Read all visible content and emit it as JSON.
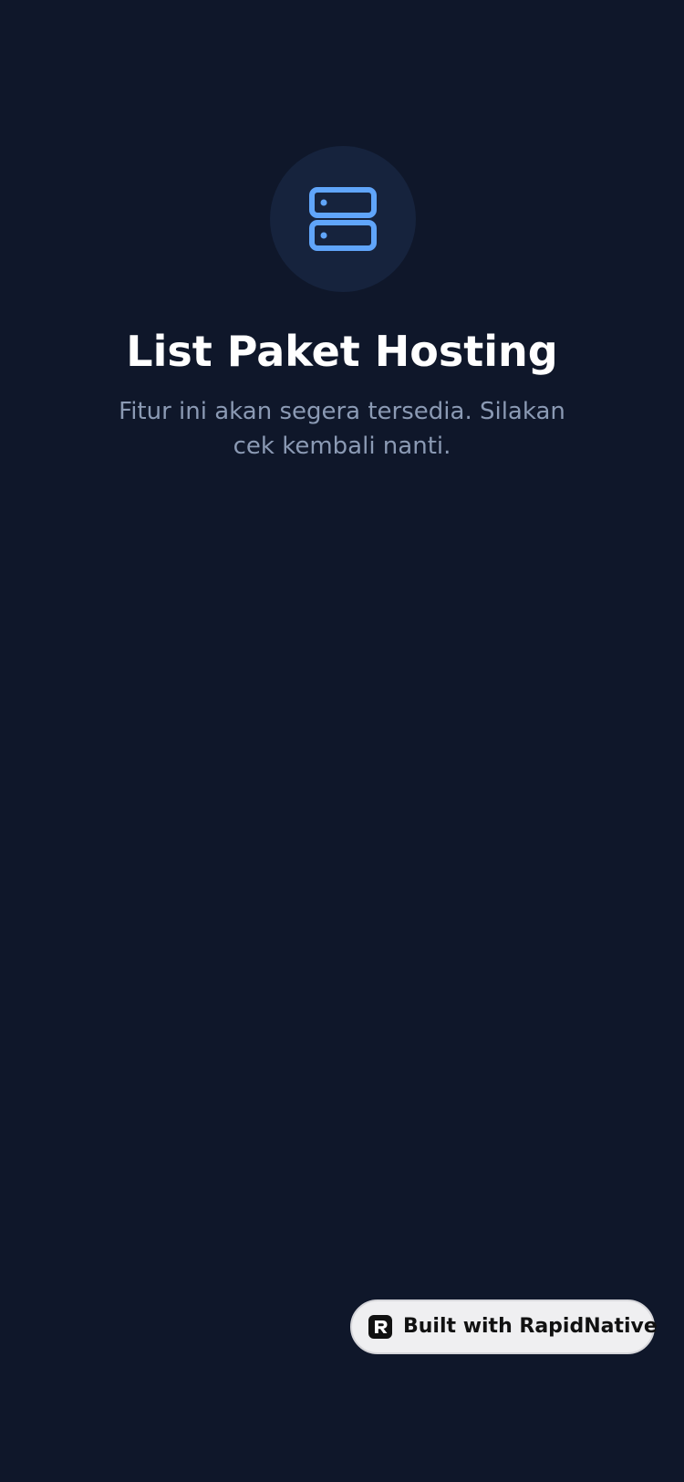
{
  "placeholder": {
    "icon": "server-icon",
    "title": "List Paket Hosting",
    "message": "Fitur ini akan segera tersedia. Silakan cek kembali nanti."
  },
  "badge": {
    "icon": "rapidnative-logo-icon",
    "label": "Built with RapidNative"
  },
  "colors": {
    "background": "#0f172a",
    "icon_circle": "#16233d",
    "icon_accent": "#60a5fa",
    "title": "#ffffff",
    "message": "#8b9ab4",
    "badge_background": "#efeff1"
  }
}
